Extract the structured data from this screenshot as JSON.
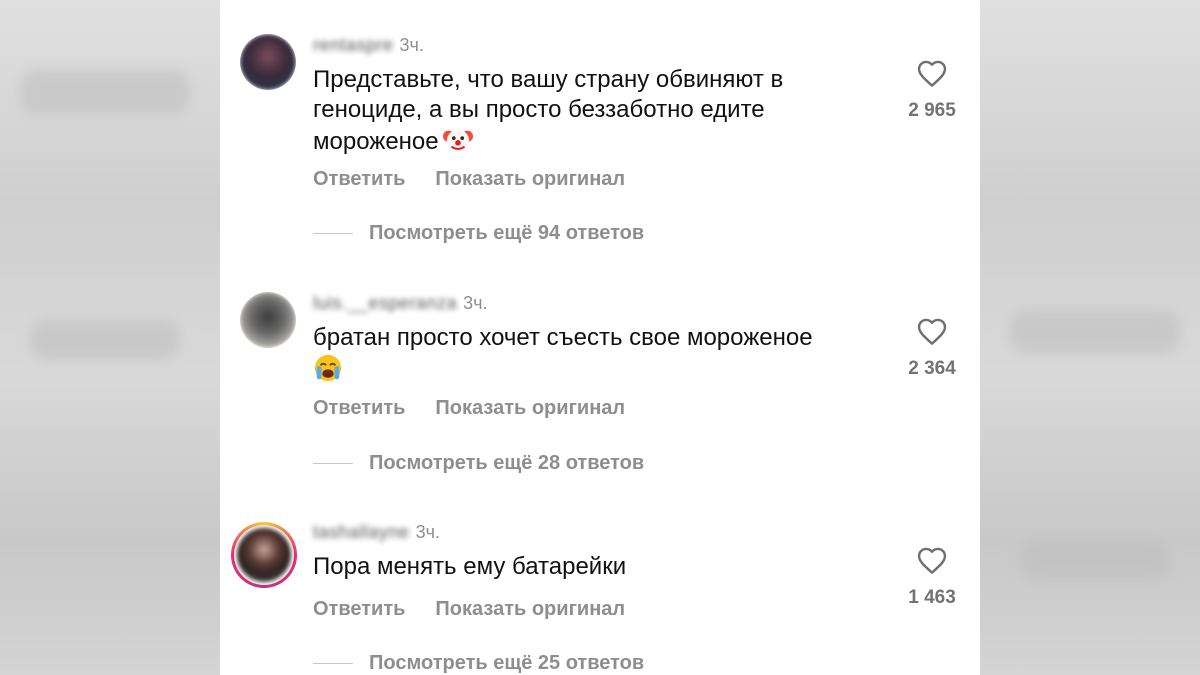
{
  "comments": [
    {
      "username": "rentaspre",
      "time": "3ч.",
      "text": "Представьте, что вашу страну обвиняют в геноциде, а вы просто беззаботно едите мороженое",
      "emoji": "clown-face-icon",
      "reply_label": "Ответить",
      "translate_label": "Показать оригинал",
      "view_replies": "Посмотреть ещё 94 ответов",
      "likes": "2 965"
    },
    {
      "username": "luis.__esperanza",
      "time": "3ч.",
      "text": "братан просто хочет съесть свое мороженое",
      "emoji": "loudly-crying-face-icon",
      "reply_label": "Ответить",
      "translate_label": "Показать оригинал",
      "view_replies": "Посмотреть ещё 28 ответов",
      "likes": "2 364"
    },
    {
      "username": "tashallayne",
      "time": "3ч.",
      "text": "Пора менять ему батарейки",
      "reply_label": "Ответить",
      "translate_label": "Показать оригинал",
      "view_replies": "Посмотреть ещё 25 ответов",
      "likes": "1 463"
    }
  ],
  "icons": {
    "like": "heart-outline-icon"
  },
  "colors": {
    "panel_bg": "#ffffff",
    "text": "#111111",
    "muted": "#8e8e8e",
    "story_ring": [
      "#f9ce34",
      "#ee2a7b",
      "#c13584"
    ]
  }
}
